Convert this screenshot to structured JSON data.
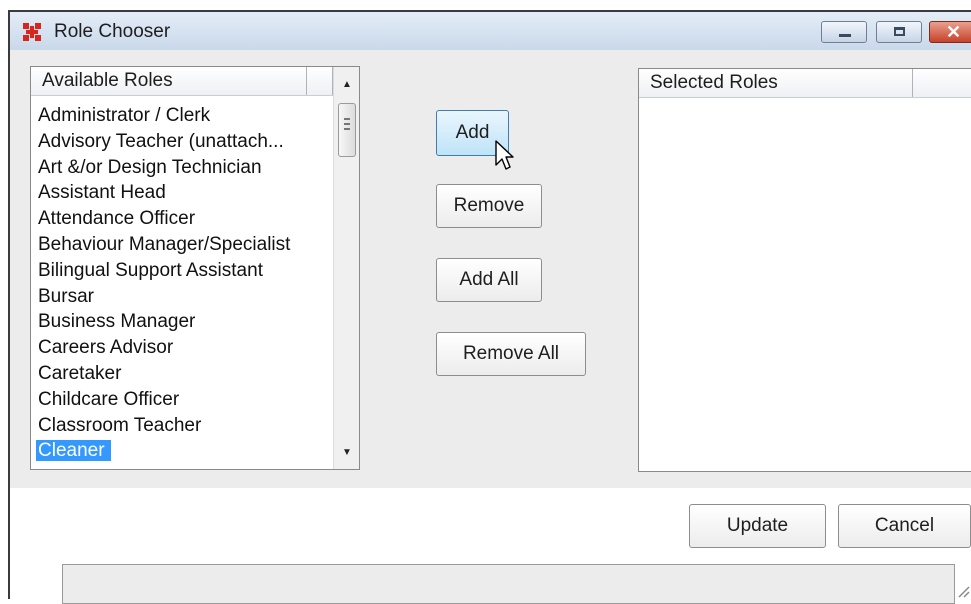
{
  "window": {
    "title": "Role Chooser"
  },
  "titlebar": {
    "icon": "red-grid-app-icon",
    "minimize_icon": "minimize-icon",
    "maximize_icon": "maximize-icon",
    "close_icon": "close-icon",
    "close_glyph": "✕"
  },
  "available": {
    "header": "Available Roles",
    "items": [
      "Administrator / Clerk",
      "Advisory Teacher (unattach...",
      "Art &/or Design Technician",
      "Assistant Head",
      "Attendance Officer",
      "Behaviour Manager/Specialist",
      "Bilingual Support Assistant",
      "Bursar",
      "Business Manager",
      "Careers Advisor",
      "Caretaker",
      "Childcare Officer",
      "Classroom Teacher",
      "Cleaner"
    ],
    "selected_item": "Cleaner"
  },
  "selected": {
    "header": "Selected Roles",
    "items": []
  },
  "actions": {
    "add": "Add",
    "remove": "Remove",
    "add_all": "Add All",
    "remove_all": "Remove All"
  },
  "footer": {
    "update": "Update",
    "cancel": "Cancel"
  },
  "colors": {
    "selection": "#3399ff",
    "close_button": "#c6422b",
    "titlebar": "#c9d8ea",
    "hover_button": "#bfe3f8"
  }
}
